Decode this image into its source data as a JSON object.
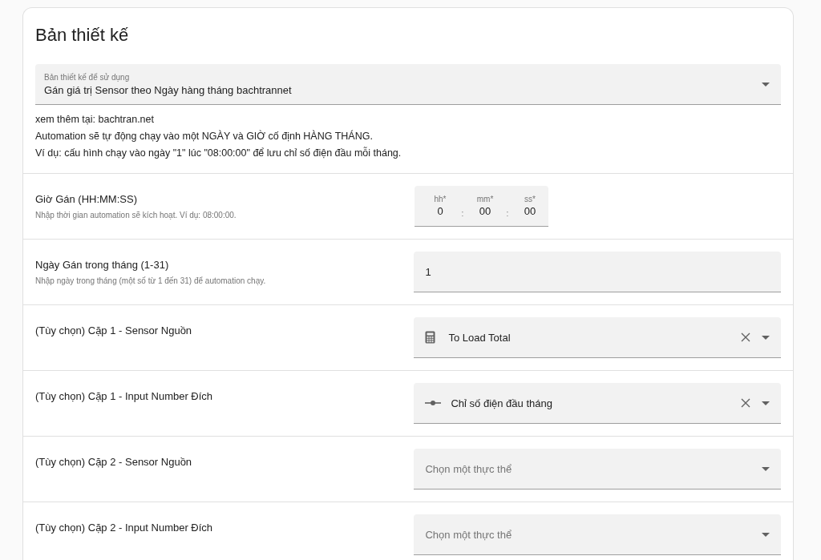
{
  "card": {
    "title": "Bản thiết kế",
    "blueprint": {
      "label": "Bản thiết kế để sử dụng",
      "value": "Gán giá trị Sensor theo Ngày hàng tháng bachtrannet"
    },
    "description": [
      "xem thêm tại: bachtran.net",
      "Automation sẽ tự động chạy vào một NGÀY và GIỜ cố định HÀNG THÁNG.",
      "Ví dụ: cấu hình chạy vào ngày \"1\" lúc \"08:00:00\" để lưu chỉ số điện đầu mỗi tháng."
    ],
    "inputs": [
      {
        "kind": "time",
        "label": "Giờ Gán (HH:MM:SS)",
        "helper": "Nhập thời gian automation sẽ kích hoạt. Ví dụ: 08:00:00.",
        "parts": [
          {
            "label": "hh*",
            "value": "0"
          },
          {
            "label": "mm*",
            "value": "00"
          },
          {
            "label": "ss*",
            "value": "00"
          }
        ],
        "separator": ":"
      },
      {
        "kind": "number",
        "label": "Ngày Gán trong tháng (1-31)",
        "helper": "Nhập ngày trong tháng (một số từ 1 đến 31) để automation chạy.",
        "value": "1"
      },
      {
        "kind": "entity",
        "label": "(Tùy chọn) Cặp 1 - Sensor Nguồn",
        "entity": {
          "kind": "sensor",
          "value": "To Load Total"
        }
      },
      {
        "kind": "entity",
        "label": "(Tùy chọn) Cặp 1 - Input Number Đích",
        "entity": {
          "kind": "input_number",
          "value": "Chỉ số điện đầu tháng"
        }
      },
      {
        "kind": "entity",
        "label": "(Tùy chọn) Cặp 2 - Sensor Nguồn",
        "placeholder": "Chọn một thực thể"
      },
      {
        "kind": "entity",
        "label": "(Tùy chọn) Cặp 2 - Input Number Đích",
        "placeholder": "Chọn một thực thể"
      }
    ]
  }
}
